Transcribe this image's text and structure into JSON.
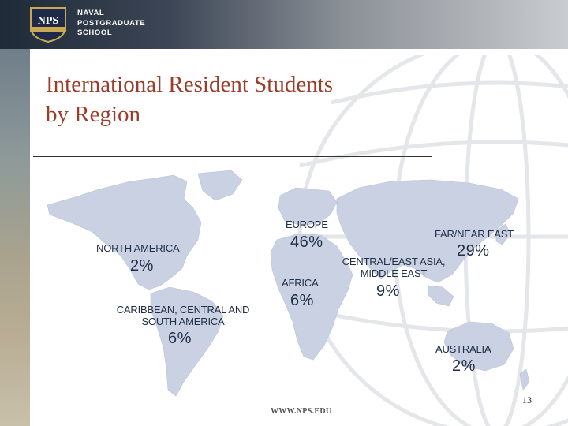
{
  "header": {
    "seal_text": "NPS",
    "logo_lines": [
      "NAVAL",
      "POSTGRADUATE",
      "SCHOOL"
    ]
  },
  "slide": {
    "title_line1": "International Resident Students",
    "title_line2": "by Region",
    "page_number": "13",
    "footer_url": "WWW.NPS.EDU"
  },
  "regions": {
    "north_america": {
      "label": "NORTH AMERICA",
      "percent": "2%"
    },
    "caribbean": {
      "label_line1": "CARIBBEAN, CENTRAL AND",
      "label_line2": "SOUTH AMERICA",
      "percent": "6%"
    },
    "europe": {
      "label": "EUROPE",
      "percent": "46%"
    },
    "africa": {
      "label": "AFRICA",
      "percent": "6%"
    },
    "central_east_asia": {
      "label_line1": "CENTRAL/EAST ASIA,",
      "label_line2": "MIDDLE EAST",
      "percent": "9%"
    },
    "far_near_east": {
      "label": "FAR/NEAR EAST",
      "percent": "29%"
    },
    "australia": {
      "label": "AUSTRALIA",
      "percent": "2%"
    }
  },
  "colors": {
    "title": "#9b3d2a",
    "label": "#222f47",
    "map_fill": "#c9d1e3"
  }
}
